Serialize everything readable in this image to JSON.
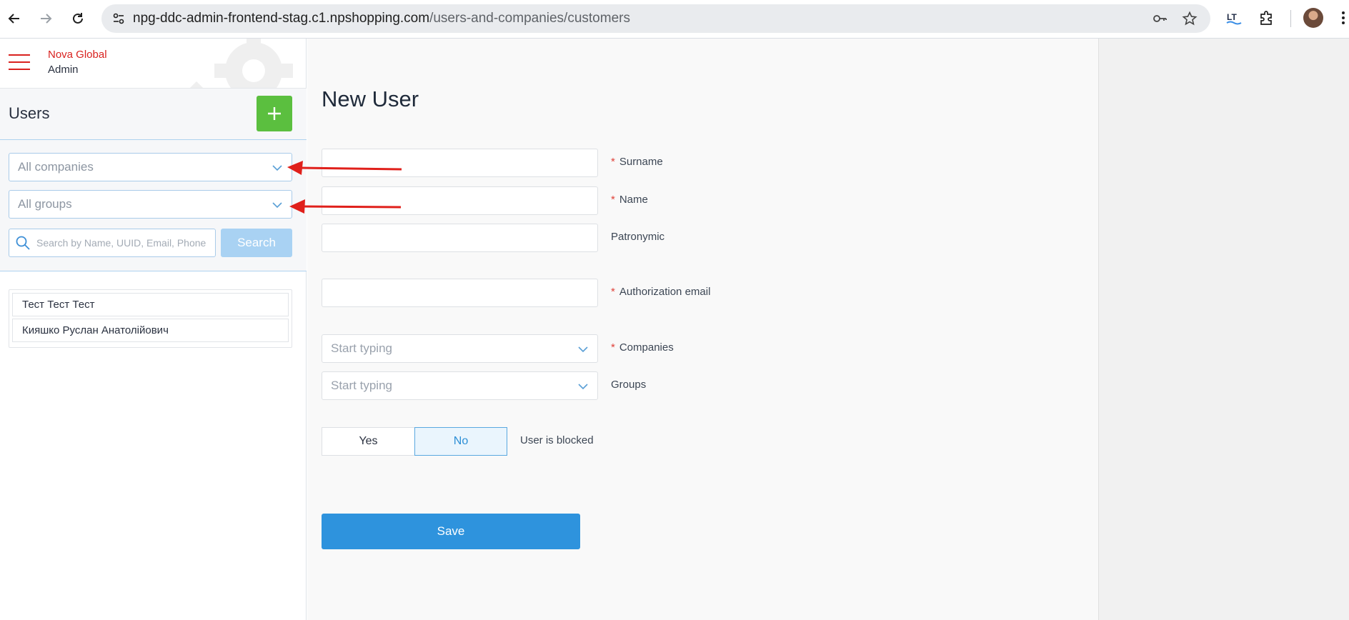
{
  "browser": {
    "url_host": "npg-ddc-admin-frontend-stag.c1.npshopping.com",
    "url_path": "/users-and-companies/customers",
    "icons": [
      "back-icon",
      "forward-icon",
      "reload-icon",
      "site-info-icon",
      "password-key-icon",
      "bookmark-star-icon",
      "extension-lt-icon",
      "extensions-puzzle-icon",
      "profile-avatar",
      "menu-dots-icon"
    ],
    "ext_lt_label": "LT"
  },
  "sidebar": {
    "brand_name": "Nova Global",
    "brand_sub": "Admin",
    "title": "Users",
    "add_label": "+",
    "filter_company": "All companies",
    "filter_group": "All groups",
    "search_placeholder": "Search by Name, UUID, Email, Phone",
    "search_button": "Search",
    "users": [
      "Тест Тест Тест",
      "Кияшко Руслан Анатолійович"
    ]
  },
  "form": {
    "title": "New User",
    "surname_label": "Surname",
    "name_label": "Name",
    "patronymic_label": "Patronymic",
    "email_label": "Authorization email",
    "companies_label": "Companies",
    "companies_placeholder": "Start typing",
    "groups_label": "Groups",
    "groups_placeholder": "Start typing",
    "required_mark": "*",
    "blocked_yes": "Yes",
    "blocked_no": "No",
    "blocked_selected": "No",
    "blocked_label": "User is blocked",
    "save_label": "Save"
  },
  "colors": {
    "accent_red": "#d9221f",
    "add_green": "#5bbf3f",
    "primary_blue": "#2e93dd",
    "search_disabled_blue": "#a9d2f3",
    "annotation_arrow": "#e0201b"
  }
}
